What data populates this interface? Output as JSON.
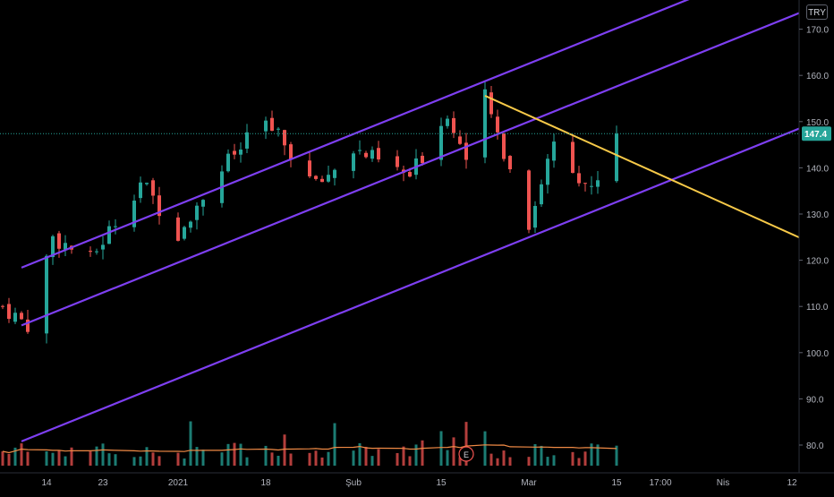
{
  "currency": "TRY",
  "last_price_label": "147.4",
  "earnings_marker": "E",
  "colors": {
    "background": "#000000",
    "up": "#26a69a",
    "down": "#ef5350",
    "channel": "#7e3ff2",
    "trendline": "#f7c948",
    "volume_ma": "#f08a45",
    "axis_text": "#b2b5be",
    "price_line": "#26a69a"
  },
  "chart_data": {
    "type": "candlestick",
    "y_axis": {
      "ticks": [
        80.0,
        90.0,
        100.0,
        110.0,
        120.0,
        130.0,
        140.0,
        150.0,
        160.0,
        170.0
      ],
      "tick_labels": [
        "80.0",
        "90.0",
        "100.0",
        "110.0",
        "120.0",
        "130.0",
        "140.0",
        "150.0",
        "160.0",
        "170.0"
      ],
      "range": [
        75,
        174
      ]
    },
    "x_axis": {
      "tick_labels": [
        "14",
        "23",
        "2021",
        "18",
        "Şub",
        "15",
        "Mar",
        "15",
        "17:00",
        "Nis",
        "12"
      ],
      "tick_dates": [
        "2020-12-14",
        "2020-12-23",
        "2021-01-04",
        "2021-01-18",
        "2021-02-01",
        "2021-02-15",
        "2021-03-01",
        "2021-03-15",
        "2021-03-22",
        "2021-04-01",
        "2021-04-12"
      ]
    },
    "last_price": 147.4,
    "price_segments": [
      {
        "from": "2020-12-07",
        "to": "2020-12-11",
        "start": 110,
        "end": 106
      },
      {
        "from": "2020-12-11",
        "to": "2020-12-15",
        "start": 106,
        "end": 125
      },
      {
        "from": "2020-12-15",
        "to": "2020-12-21",
        "start": 125,
        "end": 120
      },
      {
        "from": "2020-12-21",
        "to": "2020-12-29",
        "start": 120,
        "end": 137
      },
      {
        "from": "2020-12-29",
        "to": "2021-01-04",
        "start": 137,
        "end": 126
      },
      {
        "from": "2021-01-04",
        "to": "2021-01-11",
        "start": 126,
        "end": 140
      },
      {
        "from": "2021-01-11",
        "to": "2021-01-18",
        "start": 140,
        "end": 150
      },
      {
        "from": "2021-01-18",
        "to": "2021-01-26",
        "start": 150,
        "end": 136
      },
      {
        "from": "2021-01-26",
        "to": "2021-02-01",
        "start": 136,
        "end": 144
      },
      {
        "from": "2021-02-01",
        "to": "2021-02-10",
        "start": 144,
        "end": 138
      },
      {
        "from": "2021-02-10",
        "to": "2021-02-16",
        "start": 138,
        "end": 152
      },
      {
        "from": "2021-02-16",
        "to": "2021-02-19",
        "start": 152,
        "end": 142
      },
      {
        "from": "2021-02-19",
        "to": "2021-02-22",
        "start": 142,
        "end": 155
      },
      {
        "from": "2021-02-22",
        "to": "2021-03-01",
        "start": 155,
        "end": 128
      },
      {
        "from": "2021-03-01",
        "to": "2021-03-05",
        "start": 128,
        "end": 146
      },
      {
        "from": "2021-03-05",
        "to": "2021-03-11",
        "start": 146,
        "end": 135
      },
      {
        "from": "2021-03-11",
        "to": "2021-03-15",
        "start": 135,
        "end": 147.4
      }
    ],
    "annotations": {
      "channel_lines": [
        {
          "from": [
            "2020-12-10",
            118.4
          ],
          "to": [
            "2021-04-15",
            187.1
          ]
        },
        {
          "from": [
            "2020-12-10",
            105.9
          ],
          "to": [
            "2021-04-15",
            174.5
          ]
        },
        {
          "from": [
            "2020-12-10",
            80.8
          ],
          "to": [
            "2021-04-15",
            149.5
          ]
        }
      ],
      "trend_line": {
        "from": [
          "2021-02-22",
          155.6
        ],
        "to": [
          "2021-04-15",
          123.8
        ]
      }
    }
  }
}
